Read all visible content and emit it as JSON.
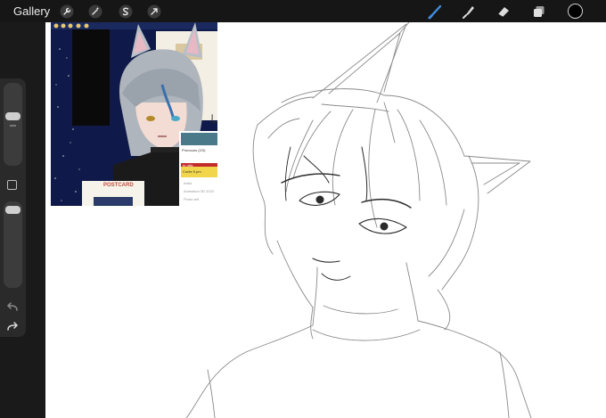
{
  "app": {
    "gallery_label": "Gallery",
    "active_color": "#000000"
  },
  "toolbar": {
    "left_icons": [
      "wrench-icon",
      "magic-wand-icon",
      "selection-icon",
      "transform-arrow-icon"
    ],
    "right_icons": [
      "brush-icon",
      "smudge-icon",
      "eraser-icon",
      "layers-icon",
      "color-swatch"
    ]
  },
  "sidebar": {
    "icons": [
      "modify-square-icon",
      "undo-icon",
      "redo-icon"
    ]
  },
  "reference": {
    "postcard_text": "POSTCARD",
    "card_title": "Pronouns (2/3)",
    "card_row_red": "to ultis",
    "card_row_yellow": "Cortie 5 pm",
    "card_lines": [
      "Artist",
      "Animation 3D 2022",
      "Photo left"
    ]
  }
}
